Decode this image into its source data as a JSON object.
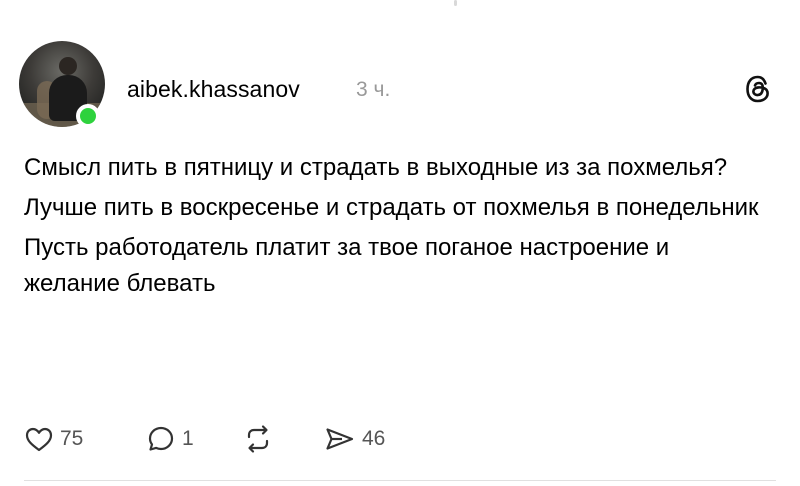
{
  "post": {
    "author": {
      "username": "aibek.khassanov",
      "time": "3 ч.",
      "online": true
    },
    "paragraphs": [
      "Смысл пить в пятницу и страдать в выходные из за похмелья?",
      "Лучше пить в воскресенье и страдать от похмелья в понедельник",
      "Пусть работодатель платит за твое поганое настроение и желание блевать"
    ],
    "actions": {
      "likes": "75",
      "replies": "1",
      "reposts": "",
      "shares": "46"
    }
  },
  "icons": {
    "like": "heart-icon",
    "reply": "comment-bubble-icon",
    "repost": "repost-icon",
    "share": "send-icon",
    "brand": "threads-logo-icon"
  },
  "colors": {
    "online": "#2ed23d",
    "meta_text": "#999999",
    "icon": "#333333"
  }
}
